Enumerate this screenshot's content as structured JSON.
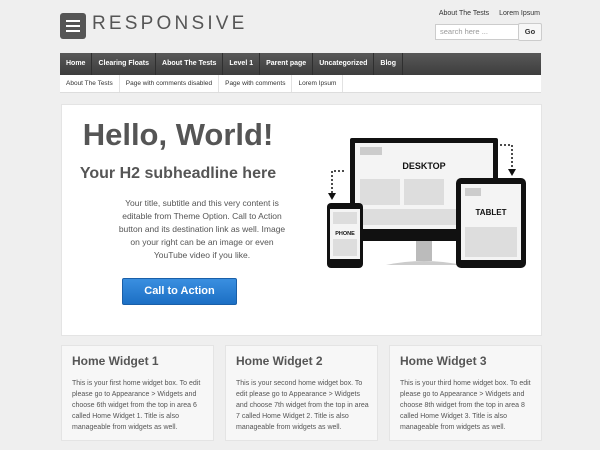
{
  "header": {
    "logo_text": "RESPONSIVE",
    "top_links": [
      "About The Tests",
      "Lorem Ipsum"
    ],
    "search_placeholder": "search here ...",
    "search_button": "Go"
  },
  "main_nav": [
    "Home",
    "Clearing Floats",
    "About The Tests",
    "Level 1",
    "Parent page",
    "Uncategorized",
    "Blog"
  ],
  "sub_nav": [
    "About The Tests",
    "Page with comments disabled",
    "Page with comments",
    "Lorem Ipsum"
  ],
  "hero": {
    "title": "Hello, World!",
    "subtitle": "Your H2 subheadline here",
    "text": "Your title, subtitle and this very content is editable from Theme Option. Call to Action button and its destination link as well. Image on your right can be an image or even YouTube video if you like.",
    "cta": "Call to Action",
    "devices": {
      "desktop": "DESKTOP",
      "tablet": "TABLET",
      "phone": "PHONE"
    }
  },
  "widgets": [
    {
      "title": "Home Widget 1",
      "text": "This is your first home widget box. To edit please go to Appearance > Widgets and choose 6th widget from the top in area 6 called Home Widget 1. Title is also manageable from widgets as well."
    },
    {
      "title": "Home Widget 2",
      "text": "This is your second home widget box. To edit please go to Appearance > Widgets and choose 7th widget from the top in area 7 called Home Widget 2. Title is also manageable from widgets as well."
    },
    {
      "title": "Home Widget 3",
      "text": "This is your third home widget box. To edit please go to Appearance > Widgets and choose 8th widget from the top in area 8 called Home Widget 3. Title is also manageable from widgets as well."
    }
  ],
  "colors": {
    "accent": "#1c6fc4",
    "nav": "#484848"
  }
}
